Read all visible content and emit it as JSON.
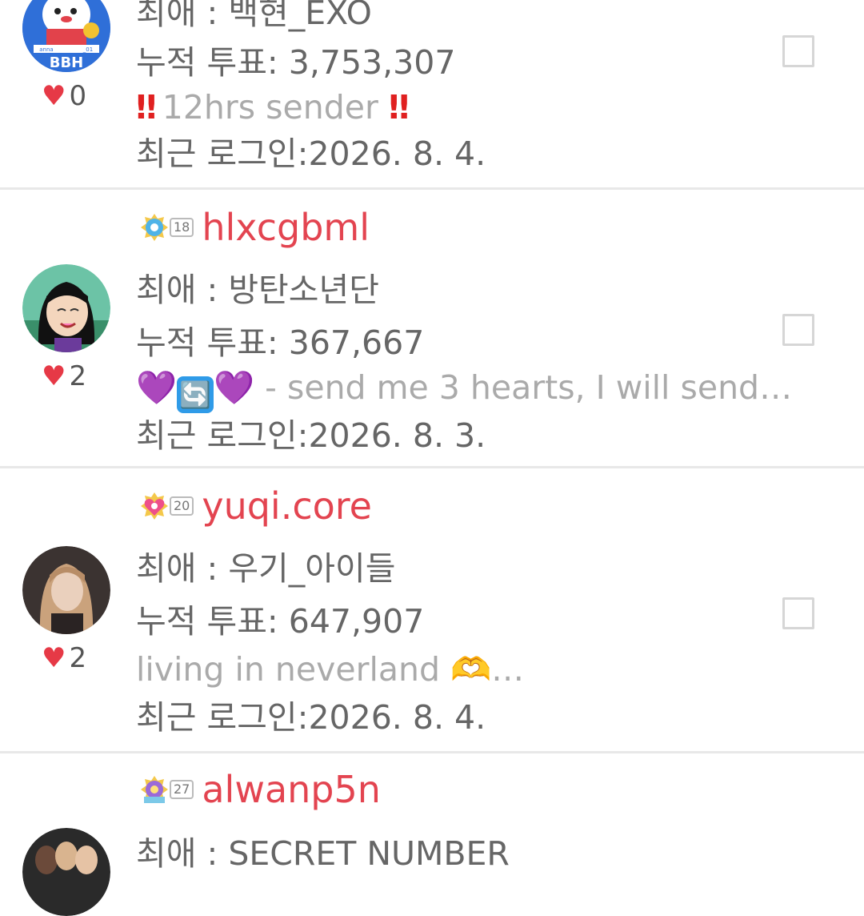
{
  "users": [
    {
      "username": "",
      "level": "",
      "favorite": "최애 : 백현_EXO",
      "votes": "누적 투표: 3,753,307",
      "status": "12hrs sender",
      "status_prefix": "‼",
      "status_suffix": "‼",
      "last_login": "최근 로그인:2026. 8. 4.",
      "likes": "0",
      "avatar_text": "BBH",
      "avatar_caption_left": "anna",
      "avatar_caption_right": "_01"
    },
    {
      "username": "hlxcgbml",
      "level": "18",
      "favorite": "최애 : 방탄소년단",
      "votes": "누적 투표: 367,667",
      "status": " - send me 3 hearts, I will send…",
      "status_emoji_1": "💜",
      "status_emoji_2": "🔄",
      "status_emoji_3": "💜",
      "last_login": "최근 로그인:2026. 8. 3.",
      "likes": "2"
    },
    {
      "username": "yuqi.core",
      "level": "20",
      "favorite": "최애 : 우기_아이들",
      "votes": "누적 투표: 647,907",
      "status": "living in neverland ",
      "status_emoji": "🫶",
      "status_trail": "…",
      "last_login": "최근 로그인:2026. 8. 4.",
      "likes": "2"
    },
    {
      "username": "alwanp5n",
      "level": "27",
      "favorite": "최애 : SECRET NUMBER"
    }
  ],
  "icons": {
    "like": "♥",
    "checkbox": "checkbox-icon"
  },
  "colors": {
    "username": "#e34450",
    "heart": "#e63946",
    "text": "#666666",
    "status": "#aaaaaa",
    "divider": "#e8e8e8"
  }
}
